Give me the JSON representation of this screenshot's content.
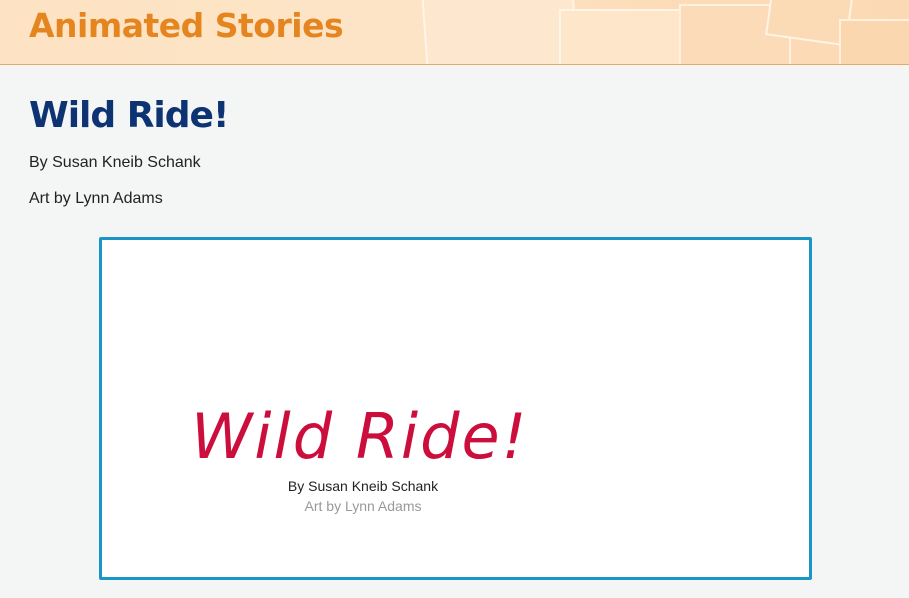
{
  "banner": {
    "title": "Animated Stories"
  },
  "story": {
    "title": "Wild Ride!",
    "author": "By Susan Kneib Schank",
    "artist": "Art by Lynn Adams"
  },
  "player": {
    "title": "Wild Ride!",
    "author": "By Susan Kneib Schank",
    "artist": "Art by Lynn Adams"
  },
  "colors": {
    "banner_text": "#e5851f",
    "story_title": "#0e3373",
    "player_border": "#1a96c6",
    "player_title": "#cc0e3c"
  }
}
